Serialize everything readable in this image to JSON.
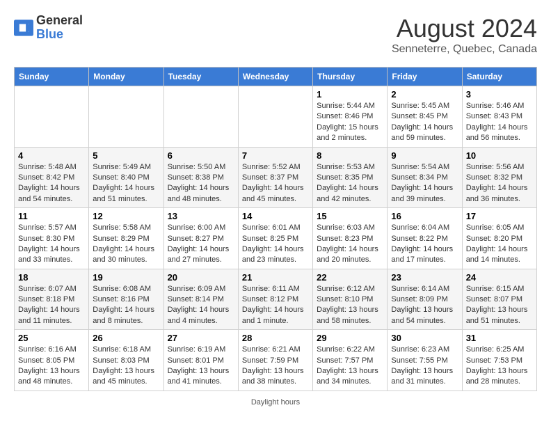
{
  "logo": {
    "text_general": "General",
    "text_blue": "Blue"
  },
  "title": "August 2024",
  "subtitle": "Senneterre, Quebec, Canada",
  "days_of_week": [
    "Sunday",
    "Monday",
    "Tuesday",
    "Wednesday",
    "Thursday",
    "Friday",
    "Saturday"
  ],
  "footer_text": "Daylight hours",
  "weeks": [
    [
      {
        "day": "",
        "sunrise": "",
        "sunset": "",
        "daylight": ""
      },
      {
        "day": "",
        "sunrise": "",
        "sunset": "",
        "daylight": ""
      },
      {
        "day": "",
        "sunrise": "",
        "sunset": "",
        "daylight": ""
      },
      {
        "day": "",
        "sunrise": "",
        "sunset": "",
        "daylight": ""
      },
      {
        "day": "1",
        "sunrise": "Sunrise: 5:44 AM",
        "sunset": "Sunset: 8:46 PM",
        "daylight": "Daylight: 15 hours and 2 minutes."
      },
      {
        "day": "2",
        "sunrise": "Sunrise: 5:45 AM",
        "sunset": "Sunset: 8:45 PM",
        "daylight": "Daylight: 14 hours and 59 minutes."
      },
      {
        "day": "3",
        "sunrise": "Sunrise: 5:46 AM",
        "sunset": "Sunset: 8:43 PM",
        "daylight": "Daylight: 14 hours and 56 minutes."
      }
    ],
    [
      {
        "day": "4",
        "sunrise": "Sunrise: 5:48 AM",
        "sunset": "Sunset: 8:42 PM",
        "daylight": "Daylight: 14 hours and 54 minutes."
      },
      {
        "day": "5",
        "sunrise": "Sunrise: 5:49 AM",
        "sunset": "Sunset: 8:40 PM",
        "daylight": "Daylight: 14 hours and 51 minutes."
      },
      {
        "day": "6",
        "sunrise": "Sunrise: 5:50 AM",
        "sunset": "Sunset: 8:38 PM",
        "daylight": "Daylight: 14 hours and 48 minutes."
      },
      {
        "day": "7",
        "sunrise": "Sunrise: 5:52 AM",
        "sunset": "Sunset: 8:37 PM",
        "daylight": "Daylight: 14 hours and 45 minutes."
      },
      {
        "day": "8",
        "sunrise": "Sunrise: 5:53 AM",
        "sunset": "Sunset: 8:35 PM",
        "daylight": "Daylight: 14 hours and 42 minutes."
      },
      {
        "day": "9",
        "sunrise": "Sunrise: 5:54 AM",
        "sunset": "Sunset: 8:34 PM",
        "daylight": "Daylight: 14 hours and 39 minutes."
      },
      {
        "day": "10",
        "sunrise": "Sunrise: 5:56 AM",
        "sunset": "Sunset: 8:32 PM",
        "daylight": "Daylight: 14 hours and 36 minutes."
      }
    ],
    [
      {
        "day": "11",
        "sunrise": "Sunrise: 5:57 AM",
        "sunset": "Sunset: 8:30 PM",
        "daylight": "Daylight: 14 hours and 33 minutes."
      },
      {
        "day": "12",
        "sunrise": "Sunrise: 5:58 AM",
        "sunset": "Sunset: 8:29 PM",
        "daylight": "Daylight: 14 hours and 30 minutes."
      },
      {
        "day": "13",
        "sunrise": "Sunrise: 6:00 AM",
        "sunset": "Sunset: 8:27 PM",
        "daylight": "Daylight: 14 hours and 27 minutes."
      },
      {
        "day": "14",
        "sunrise": "Sunrise: 6:01 AM",
        "sunset": "Sunset: 8:25 PM",
        "daylight": "Daylight: 14 hours and 23 minutes."
      },
      {
        "day": "15",
        "sunrise": "Sunrise: 6:03 AM",
        "sunset": "Sunset: 8:23 PM",
        "daylight": "Daylight: 14 hours and 20 minutes."
      },
      {
        "day": "16",
        "sunrise": "Sunrise: 6:04 AM",
        "sunset": "Sunset: 8:22 PM",
        "daylight": "Daylight: 14 hours and 17 minutes."
      },
      {
        "day": "17",
        "sunrise": "Sunrise: 6:05 AM",
        "sunset": "Sunset: 8:20 PM",
        "daylight": "Daylight: 14 hours and 14 minutes."
      }
    ],
    [
      {
        "day": "18",
        "sunrise": "Sunrise: 6:07 AM",
        "sunset": "Sunset: 8:18 PM",
        "daylight": "Daylight: 14 hours and 11 minutes."
      },
      {
        "day": "19",
        "sunrise": "Sunrise: 6:08 AM",
        "sunset": "Sunset: 8:16 PM",
        "daylight": "Daylight: 14 hours and 8 minutes."
      },
      {
        "day": "20",
        "sunrise": "Sunrise: 6:09 AM",
        "sunset": "Sunset: 8:14 PM",
        "daylight": "Daylight: 14 hours and 4 minutes."
      },
      {
        "day": "21",
        "sunrise": "Sunrise: 6:11 AM",
        "sunset": "Sunset: 8:12 PM",
        "daylight": "Daylight: 14 hours and 1 minute."
      },
      {
        "day": "22",
        "sunrise": "Sunrise: 6:12 AM",
        "sunset": "Sunset: 8:10 PM",
        "daylight": "Daylight: 13 hours and 58 minutes."
      },
      {
        "day": "23",
        "sunrise": "Sunrise: 6:14 AM",
        "sunset": "Sunset: 8:09 PM",
        "daylight": "Daylight: 13 hours and 54 minutes."
      },
      {
        "day": "24",
        "sunrise": "Sunrise: 6:15 AM",
        "sunset": "Sunset: 8:07 PM",
        "daylight": "Daylight: 13 hours and 51 minutes."
      }
    ],
    [
      {
        "day": "25",
        "sunrise": "Sunrise: 6:16 AM",
        "sunset": "Sunset: 8:05 PM",
        "daylight": "Daylight: 13 hours and 48 minutes."
      },
      {
        "day": "26",
        "sunrise": "Sunrise: 6:18 AM",
        "sunset": "Sunset: 8:03 PM",
        "daylight": "Daylight: 13 hours and 45 minutes."
      },
      {
        "day": "27",
        "sunrise": "Sunrise: 6:19 AM",
        "sunset": "Sunset: 8:01 PM",
        "daylight": "Daylight: 13 hours and 41 minutes."
      },
      {
        "day": "28",
        "sunrise": "Sunrise: 6:21 AM",
        "sunset": "Sunset: 7:59 PM",
        "daylight": "Daylight: 13 hours and 38 minutes."
      },
      {
        "day": "29",
        "sunrise": "Sunrise: 6:22 AM",
        "sunset": "Sunset: 7:57 PM",
        "daylight": "Daylight: 13 hours and 34 minutes."
      },
      {
        "day": "30",
        "sunrise": "Sunrise: 6:23 AM",
        "sunset": "Sunset: 7:55 PM",
        "daylight": "Daylight: 13 hours and 31 minutes."
      },
      {
        "day": "31",
        "sunrise": "Sunrise: 6:25 AM",
        "sunset": "Sunset: 7:53 PM",
        "daylight": "Daylight: 13 hours and 28 minutes."
      }
    ]
  ]
}
